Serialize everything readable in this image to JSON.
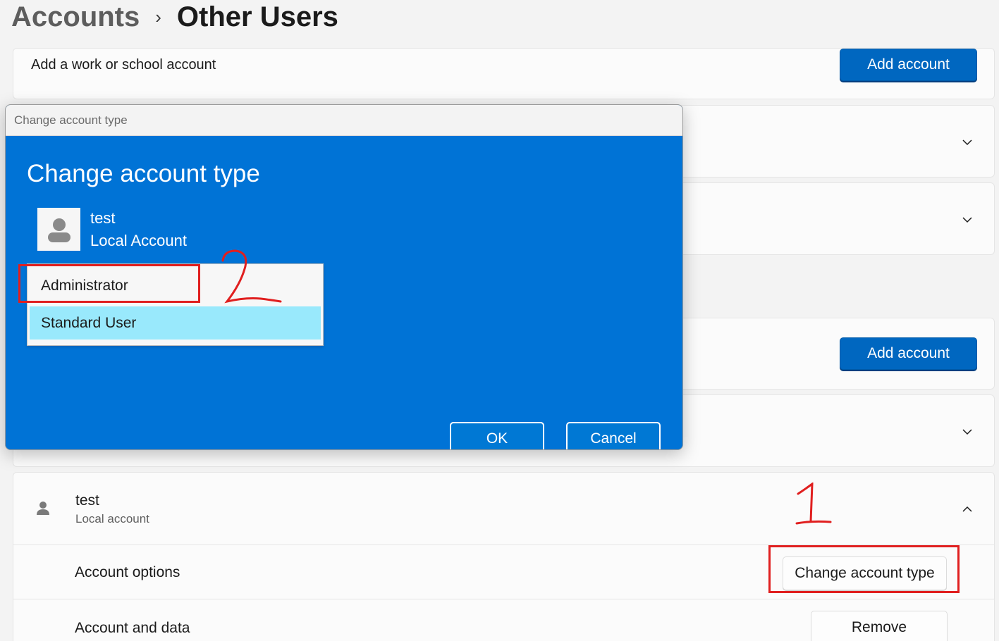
{
  "breadcrumb": {
    "parent": "Accounts",
    "separator": "›",
    "current": "Other Users"
  },
  "work_school": {
    "label": "Add a work or school account",
    "button": "Add account"
  },
  "family_section": {
    "button": "Add account"
  },
  "user_card": {
    "name": "test",
    "type": "Local account"
  },
  "account_options": {
    "label": "Account options",
    "button": "Change account type"
  },
  "account_data": {
    "label": "Account and data",
    "button": "Remove"
  },
  "dialog": {
    "window_title": "Change account type",
    "heading": "Change account type",
    "user_name": "test",
    "user_type": "Local Account",
    "options": [
      "Administrator",
      "Standard User"
    ],
    "selected_option": "Standard User",
    "ok_label": "OK",
    "cancel_label": "Cancel"
  },
  "annotations": {
    "step1": "1",
    "step2": "2",
    "color": "#e01f1f"
  },
  "colors": {
    "accent": "#0067c0",
    "dialog_bg": "#0073d6",
    "selected_option_bg": "#99e9fc"
  }
}
